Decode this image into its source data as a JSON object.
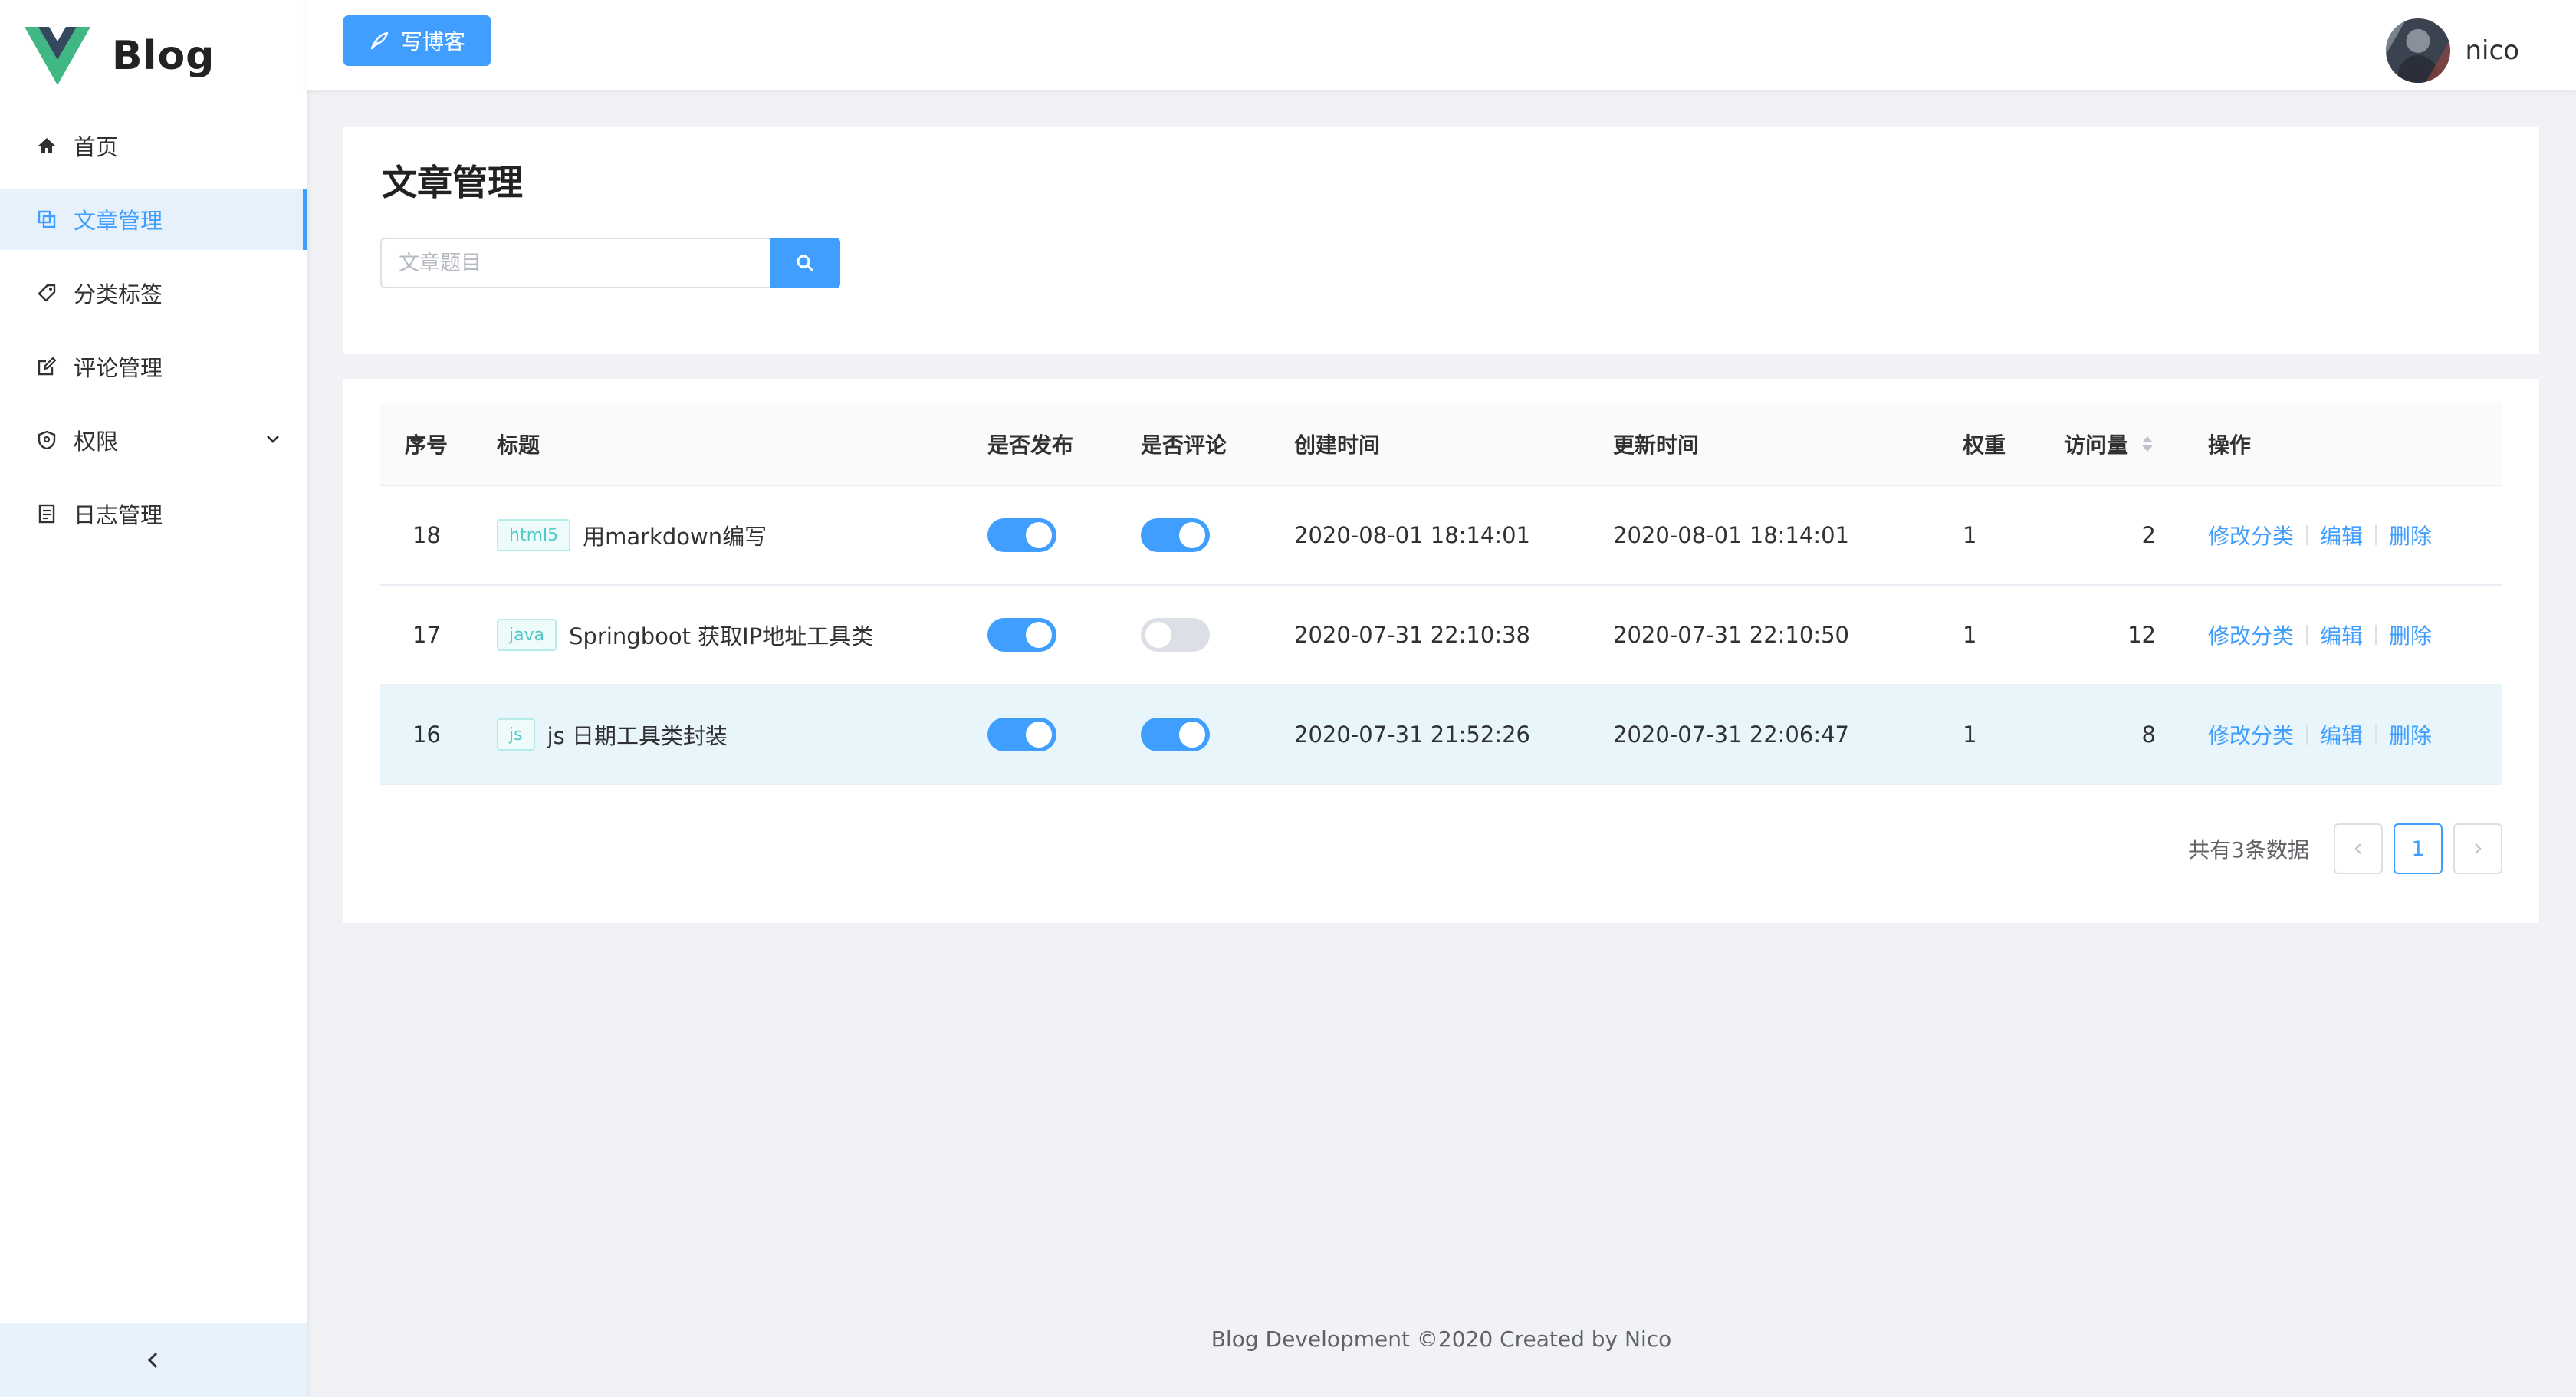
{
  "brand": {
    "name": "Blog"
  },
  "sidebar": {
    "items": [
      {
        "label": "首页",
        "icon": "home-icon"
      },
      {
        "label": "文章管理",
        "icon": "article-icon",
        "active": true
      },
      {
        "label": "分类标签",
        "icon": "tag-icon"
      },
      {
        "label": "评论管理",
        "icon": "edit-icon"
      },
      {
        "label": "权限",
        "icon": "shield-icon",
        "expandable": true
      },
      {
        "label": "日志管理",
        "icon": "log-icon"
      }
    ]
  },
  "header": {
    "write_label": "写博客",
    "username": "nico"
  },
  "page": {
    "title": "文章管理",
    "search_placeholder": "文章题目"
  },
  "table": {
    "headers": {
      "index": "序号",
      "title": "标题",
      "published": "是否发布",
      "comment": "是否评论",
      "created": "创建时间",
      "updated": "更新时间",
      "weight": "权重",
      "views": "访问量",
      "actions": "操作"
    },
    "rows": [
      {
        "index": "18",
        "tag": "html5",
        "title": "用markdown编写",
        "published": true,
        "comment": true,
        "created": "2020-08-01 18:14:01",
        "updated": "2020-08-01 18:14:01",
        "weight": "1",
        "views": "2"
      },
      {
        "index": "17",
        "tag": "java",
        "title": "Springboot 获取IP地址工具类",
        "published": true,
        "comment": false,
        "created": "2020-07-31 22:10:38",
        "updated": "2020-07-31 22:10:50",
        "weight": "1",
        "views": "12"
      },
      {
        "index": "16",
        "tag": "js",
        "title": "js 日期工具类封装",
        "published": true,
        "comment": true,
        "created": "2020-07-31 21:52:26",
        "updated": "2020-07-31 22:06:47",
        "weight": "1",
        "views": "8"
      }
    ],
    "actions": {
      "change_category": "修改分类",
      "edit": "编辑",
      "delete": "删除"
    }
  },
  "pagination": {
    "total_text": "共有3条数据",
    "current": "1"
  },
  "footer": {
    "text": "Blog Development ©2020 Created by Nico"
  },
  "colors": {
    "primary": "#409eff",
    "sidebar_active_bg": "#e6f1fc",
    "tag": "#4ec9c5"
  }
}
